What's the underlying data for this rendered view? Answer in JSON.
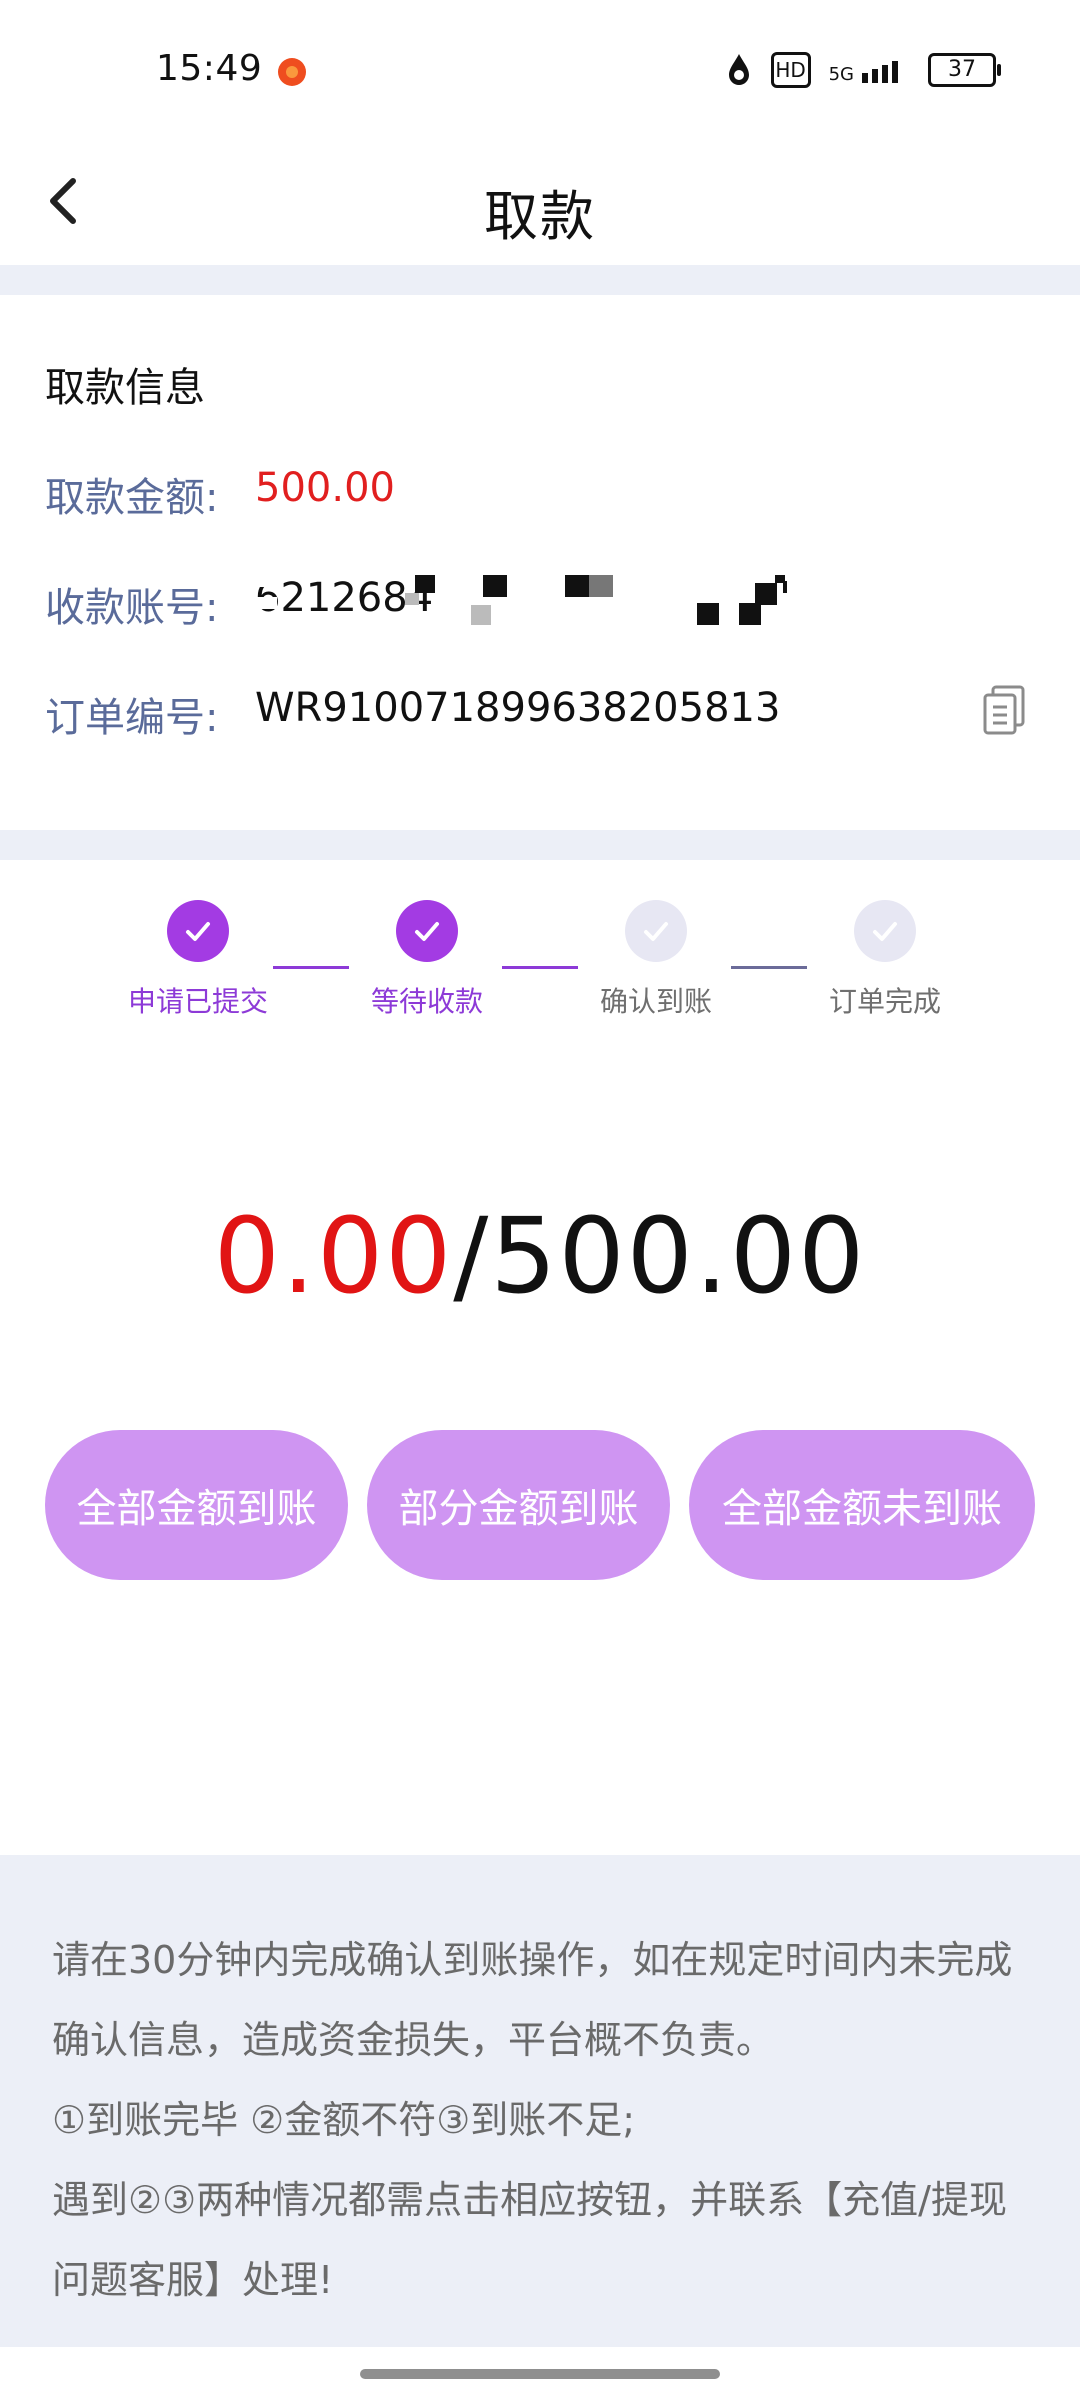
{
  "status_bar": {
    "time": "15:49",
    "network": "5G",
    "hd_label": "HD",
    "battery": "37"
  },
  "header": {
    "title": "取款"
  },
  "info": {
    "section_title": "取款信息",
    "amount_label": "取款金额:",
    "amount_value": "500.00",
    "account_label": "收款账号:",
    "account_value_visible": "6212684",
    "order_label": "订单编号:",
    "order_value": "WR910071899638205813"
  },
  "steps": [
    {
      "label": "申请已提交",
      "status": "done"
    },
    {
      "label": "等待收款",
      "status": "done"
    },
    {
      "label": "确认到账",
      "status": "todo"
    },
    {
      "label": "订单完成",
      "status": "todo"
    }
  ],
  "amount_display": {
    "received": "0.00",
    "slash": "/",
    "total": "500.00"
  },
  "actions": [
    {
      "label": "全部金额到账"
    },
    {
      "label": "部分金额到账"
    },
    {
      "label": "全部金额未到账"
    }
  ],
  "notice": {
    "line1": "请在30分钟内完成确认到账操作，如在规定时间内未完成确认信息，造成资金损失，平台概不负责。",
    "line2": "①到账完毕 ②金额不符③到账不足;",
    "line3": "遇到②③两种情况都需点击相应按钮，并联系【充值/提现问题客服】处理!"
  },
  "colors": {
    "accent": "#a33be3",
    "button_bg": "#cf95f2",
    "red": "#e11414",
    "band": "#eceff7"
  }
}
